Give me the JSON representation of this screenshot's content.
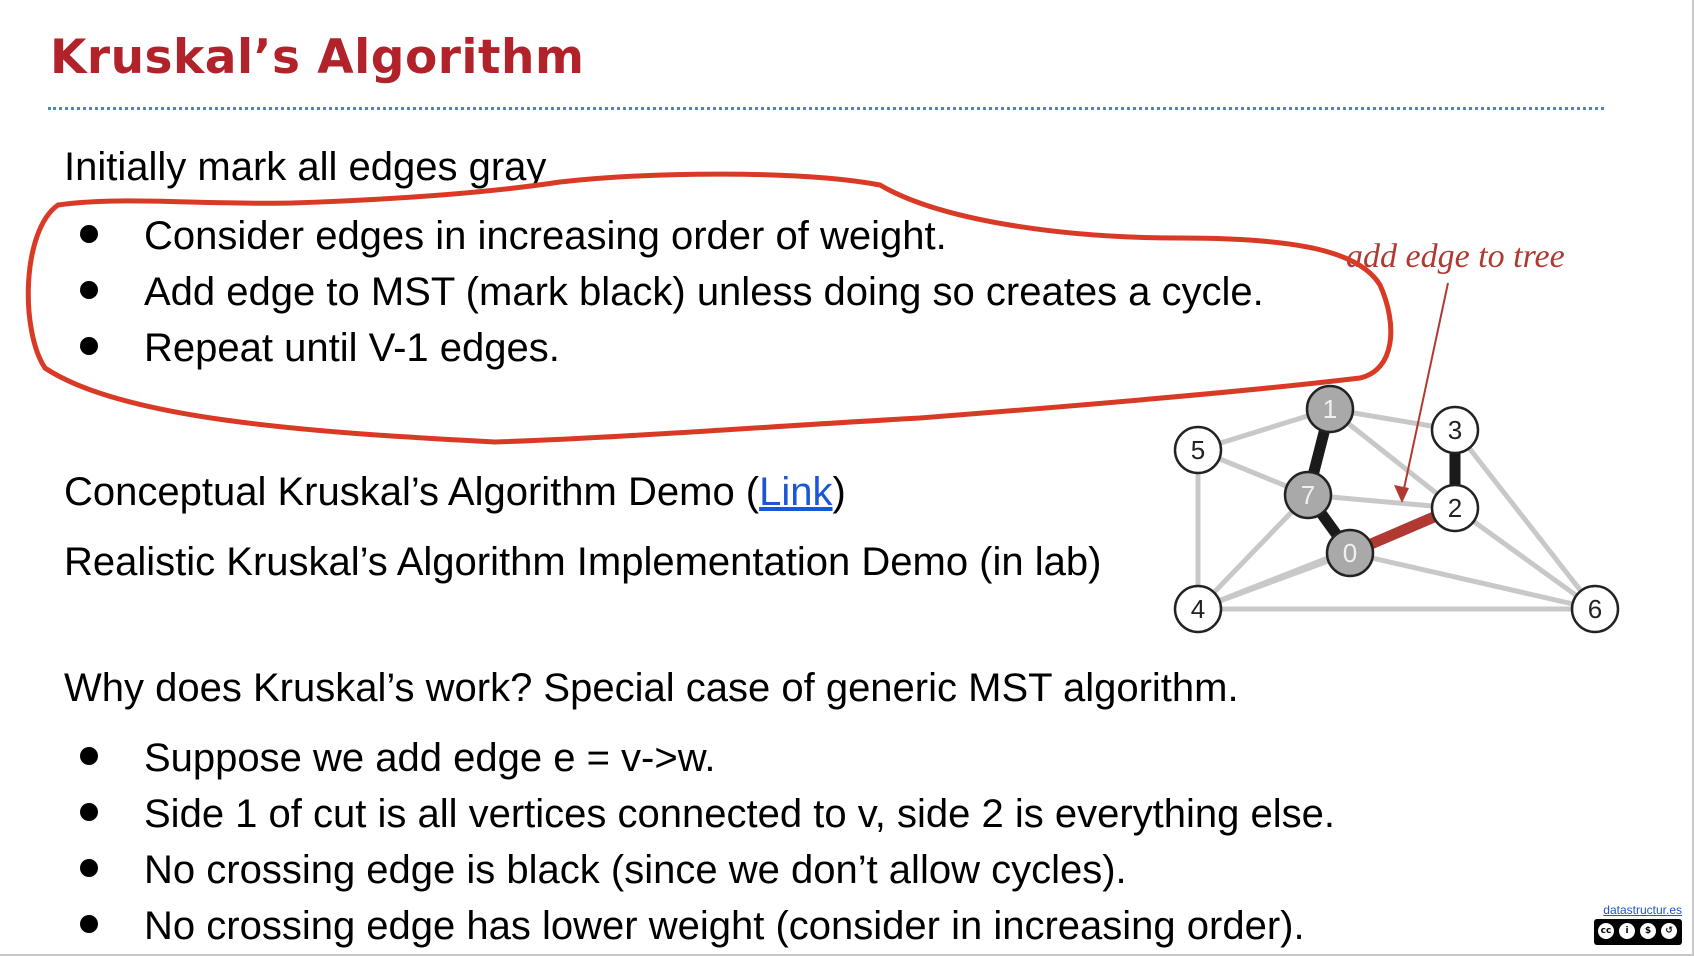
{
  "slide": {
    "title": "Kruskal’s Algorithm",
    "intro": "Initially mark all edges gray",
    "steps": [
      "Consider edges in increasing order of weight.",
      "Add edge to MST (mark black) unless doing so creates a cycle.",
      "Repeat until V-1 edges."
    ],
    "demo_conceptual_prefix": "Conceptual Kruskal’s Algorithm Demo (",
    "demo_conceptual_link": "Link",
    "demo_conceptual_suffix": ")",
    "demo_realistic": "Realistic Kruskal’s Algorithm Implementation Demo (in lab)",
    "why_heading": "Why does Kruskal’s work? Special case of generic MST algorithm.",
    "why_points": [
      "Suppose we add edge e = v->w.",
      "Side 1 of cut is all vertices connected to v, side 2 is everything else.",
      "No crossing edge is black (since we don’t allow cycles).",
      "No crossing edge has lower weight (consider in increasing order)."
    ]
  },
  "graph": {
    "annotation": "add edge to tree",
    "nodes": [
      {
        "id": "0",
        "label": "0",
        "in_tree": true
      },
      {
        "id": "1",
        "label": "1",
        "in_tree": true
      },
      {
        "id": "2",
        "label": "2",
        "in_tree": false
      },
      {
        "id": "3",
        "label": "3",
        "in_tree": false
      },
      {
        "id": "4",
        "label": "4",
        "in_tree": false
      },
      {
        "id": "5",
        "label": "5",
        "in_tree": false
      },
      {
        "id": "6",
        "label": "6",
        "in_tree": false
      },
      {
        "id": "7",
        "label": "7",
        "in_tree": true
      }
    ],
    "edges": [
      {
        "from": "1",
        "to": "7",
        "state": "black"
      },
      {
        "from": "7",
        "to": "0",
        "state": "black"
      },
      {
        "from": "2",
        "to": "3",
        "state": "black"
      },
      {
        "from": "0",
        "to": "2",
        "state": "red"
      },
      {
        "from": "5",
        "to": "1",
        "state": "gray"
      },
      {
        "from": "5",
        "to": "7",
        "state": "gray"
      },
      {
        "from": "5",
        "to": "4",
        "state": "gray"
      },
      {
        "from": "1",
        "to": "3",
        "state": "gray"
      },
      {
        "from": "1",
        "to": "2",
        "state": "gray"
      },
      {
        "from": "7",
        "to": "2",
        "state": "gray"
      },
      {
        "from": "7",
        "to": "4",
        "state": "gray"
      },
      {
        "from": "0",
        "to": "4",
        "state": "gray"
      },
      {
        "from": "0",
        "to": "6",
        "state": "gray"
      },
      {
        "from": "4",
        "to": "6",
        "state": "gray"
      },
      {
        "from": "4",
        "to": "2",
        "state": "gray"
      },
      {
        "from": "3",
        "to": "6",
        "state": "gray"
      },
      {
        "from": "2",
        "to": "6",
        "state": "gray"
      }
    ]
  },
  "attribution": {
    "site": "datastructur.es",
    "license_icons": [
      "cc-icon",
      "by-icon",
      "nc-icon",
      "sa-icon"
    ]
  },
  "colors": {
    "title": "#b2222a",
    "rule": "#4a86c8",
    "link": "#1a56d6",
    "annotation_marker": "#d93a25",
    "tree_edge": "#1a1a1a",
    "new_edge": "#b03a32",
    "gray_edge": "#c8c8c8",
    "tree_node": "#a9a9a9"
  }
}
